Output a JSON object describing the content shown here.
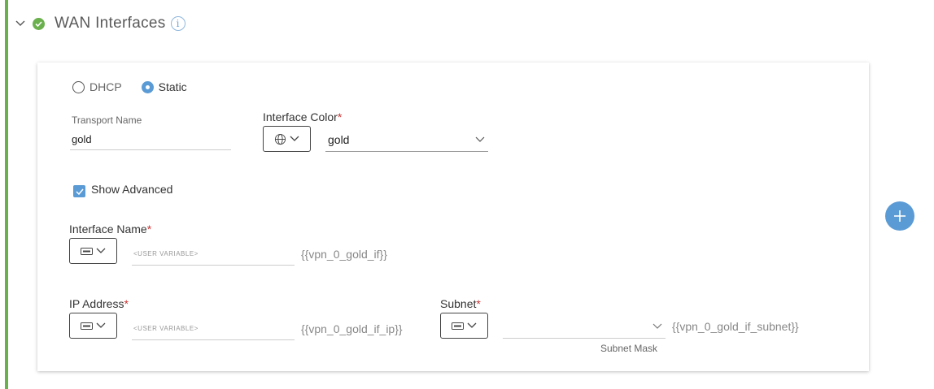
{
  "section": {
    "title": "WAN Interfaces",
    "info_glyph": "i",
    "status_color": "#6ab04c"
  },
  "mode": {
    "options": [
      "DHCP",
      "Static"
    ],
    "selected": "Static"
  },
  "transport_name": {
    "label": "Transport Name",
    "value": "gold"
  },
  "interface_color": {
    "label": "Interface Color",
    "required_mark": "*",
    "icon": "globe-icon",
    "value": "gold"
  },
  "show_advanced": {
    "label": "Show Advanced",
    "checked": true
  },
  "interface_name": {
    "label": "Interface Name",
    "required_mark": "*",
    "placeholder": "<USER VARIABLE>",
    "variable": "{{vpn_0_gold_if}}",
    "icon": "variable-icon"
  },
  "ip_address": {
    "label": "IP Address",
    "required_mark": "*",
    "placeholder": "<USER VARIABLE>",
    "variable": "{{vpn_0_gold_if_ip}}",
    "icon": "variable-icon"
  },
  "subnet": {
    "label": "Subnet",
    "required_mark": "*",
    "caption": "Subnet Mask",
    "variable": "{{vpn_0_gold_if_subnet}}",
    "icon": "variable-icon"
  },
  "accent_color": "#5b9bd5"
}
